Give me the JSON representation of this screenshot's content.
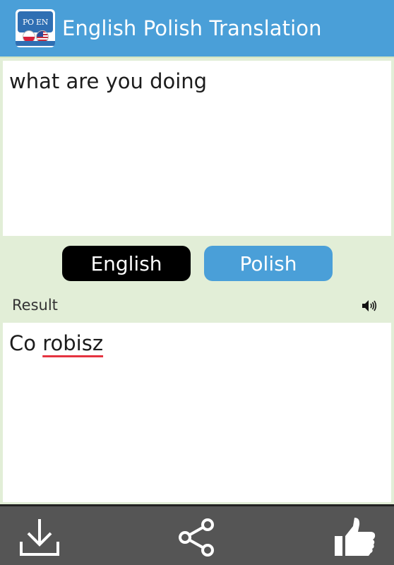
{
  "app_bar": {
    "title": "English Polish Translation",
    "logo_text": "PO EN",
    "icon": "app-logo"
  },
  "input": {
    "text": "what are you doing"
  },
  "language_buttons": {
    "source": "English",
    "target": "Polish"
  },
  "result": {
    "label": "Result",
    "speaker_icon": "speaker-icon",
    "text_plain": "Co ",
    "text_flagged": "robisz"
  },
  "bottom_bar": {
    "icons": [
      "download-icon",
      "share-icon",
      "thumbs-up-icon"
    ]
  },
  "colors": {
    "app_bar": "#4a9fd8",
    "background": "#e2eed7",
    "source_button": "#000000",
    "target_button": "#4a9fd8",
    "bottom_bar": "#555555",
    "spellcheck_underline": "#e53340"
  }
}
